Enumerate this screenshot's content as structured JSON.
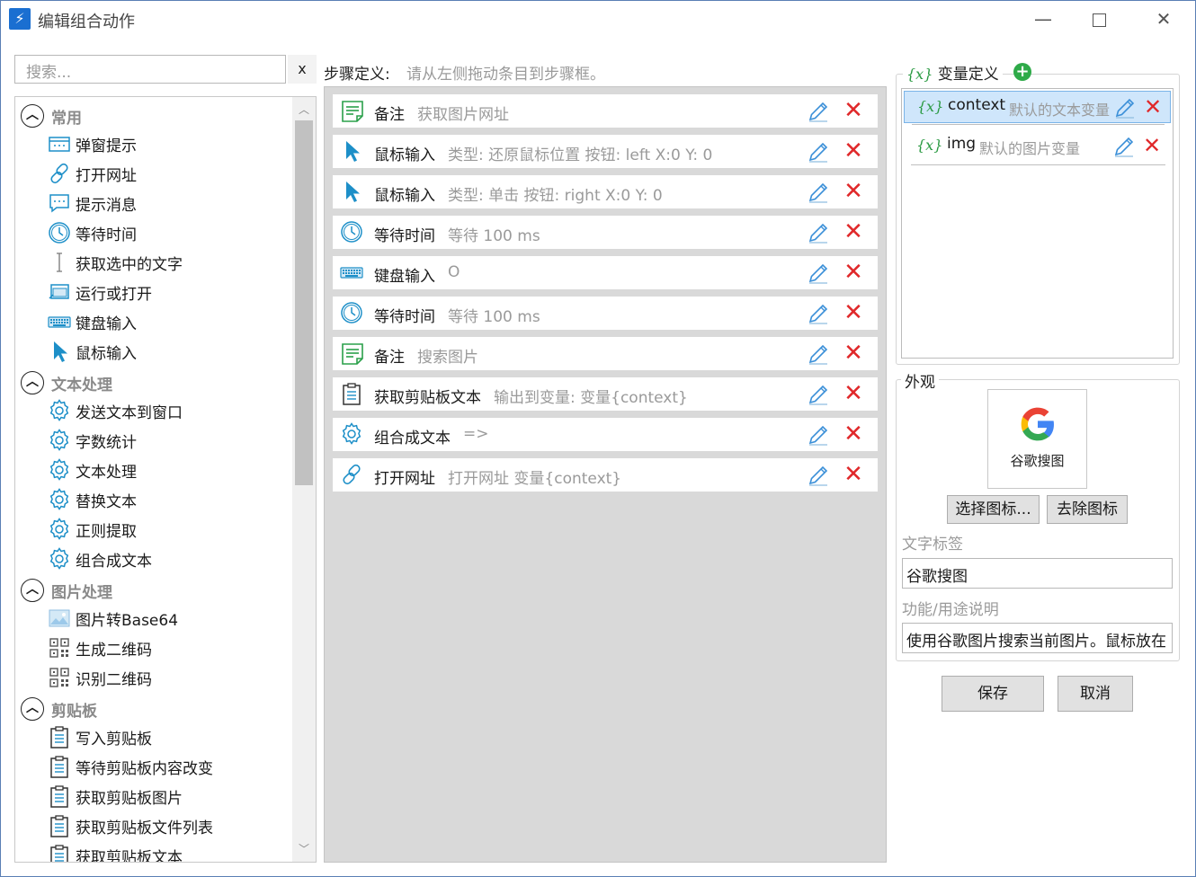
{
  "window": {
    "title": "编辑组合动作",
    "min": "—",
    "close": "✕"
  },
  "search": {
    "placeholder": "搜索...",
    "clear": "x"
  },
  "sidebar": {
    "groups": [
      {
        "label": "常用",
        "items": [
          "弹窗提示",
          "打开网址",
          "提示消息",
          "等待时间",
          "获取选中的文字",
          "运行或打开",
          "键盘输入",
          "鼠标输入"
        ]
      },
      {
        "label": "文本处理",
        "items": [
          "发送文本到窗口",
          "字数统计",
          "文本处理",
          "替换文本",
          "正则提取",
          "组合成文本"
        ]
      },
      {
        "label": "图片处理",
        "items": [
          "图片转Base64",
          "生成二维码",
          "识别二维码"
        ]
      },
      {
        "label": "剪贴板",
        "items": [
          "写入剪贴板",
          "等待剪贴板内容改变",
          "获取剪贴板图片",
          "获取剪贴板文件列表",
          "获取剪贴板文本"
        ]
      }
    ]
  },
  "steps": {
    "label": "步骤定义:",
    "hint": "请从左侧拖动条目到步骤框。",
    "items": [
      {
        "icon": "note-icon",
        "name": "备注",
        "desc": "获取图片网址"
      },
      {
        "icon": "mouse-cursor-icon",
        "name": "鼠标输入",
        "desc": "类型: 还原鼠标位置  按钮: left   X:0   Y: 0"
      },
      {
        "icon": "mouse-cursor-icon",
        "name": "鼠标输入",
        "desc": "类型: 单击  按钮: right   X:0   Y: 0"
      },
      {
        "icon": "clock-icon",
        "name": "等待时间",
        "desc": "等待 100 ms"
      },
      {
        "icon": "keyboard-icon",
        "name": "键盘输入",
        "desc": "O"
      },
      {
        "icon": "clock-icon",
        "name": "等待时间",
        "desc": "等待 100 ms"
      },
      {
        "icon": "note-icon",
        "name": "备注",
        "desc": "搜索图片"
      },
      {
        "icon": "clipboard-icon",
        "name": "获取剪贴板文本",
        "desc": "输出到变量: 变量{context}"
      },
      {
        "icon": "gear-icon",
        "name": "组合成文本",
        "desc": "=>"
      },
      {
        "icon": "link-icon",
        "name": "打开网址",
        "desc": "打开网址 变量{context}"
      }
    ]
  },
  "variables": {
    "title": "变量定义",
    "symbol": "{x}",
    "items": [
      {
        "name": "context",
        "desc": "默认的文本变量"
      },
      {
        "name": "img",
        "desc": "默认的图片变量"
      }
    ]
  },
  "appearance": {
    "title": "外观",
    "icon_caption": "谷歌搜图",
    "choose_icon": "选择图标...",
    "remove_icon": "去除图标",
    "text_label_caption": "文字标签",
    "text_label_value": "谷歌搜图",
    "desc_caption": "功能/用途说明",
    "desc_value": "使用谷歌图片搜索当前图片。鼠标放在"
  },
  "actions": {
    "save": "保存",
    "cancel": "取消"
  },
  "colors": {
    "accent_green": "#2eaa48",
    "delete_red": "#e0282a",
    "selection": "#cfe6fb",
    "icon_blue": "#1d8fc8"
  }
}
